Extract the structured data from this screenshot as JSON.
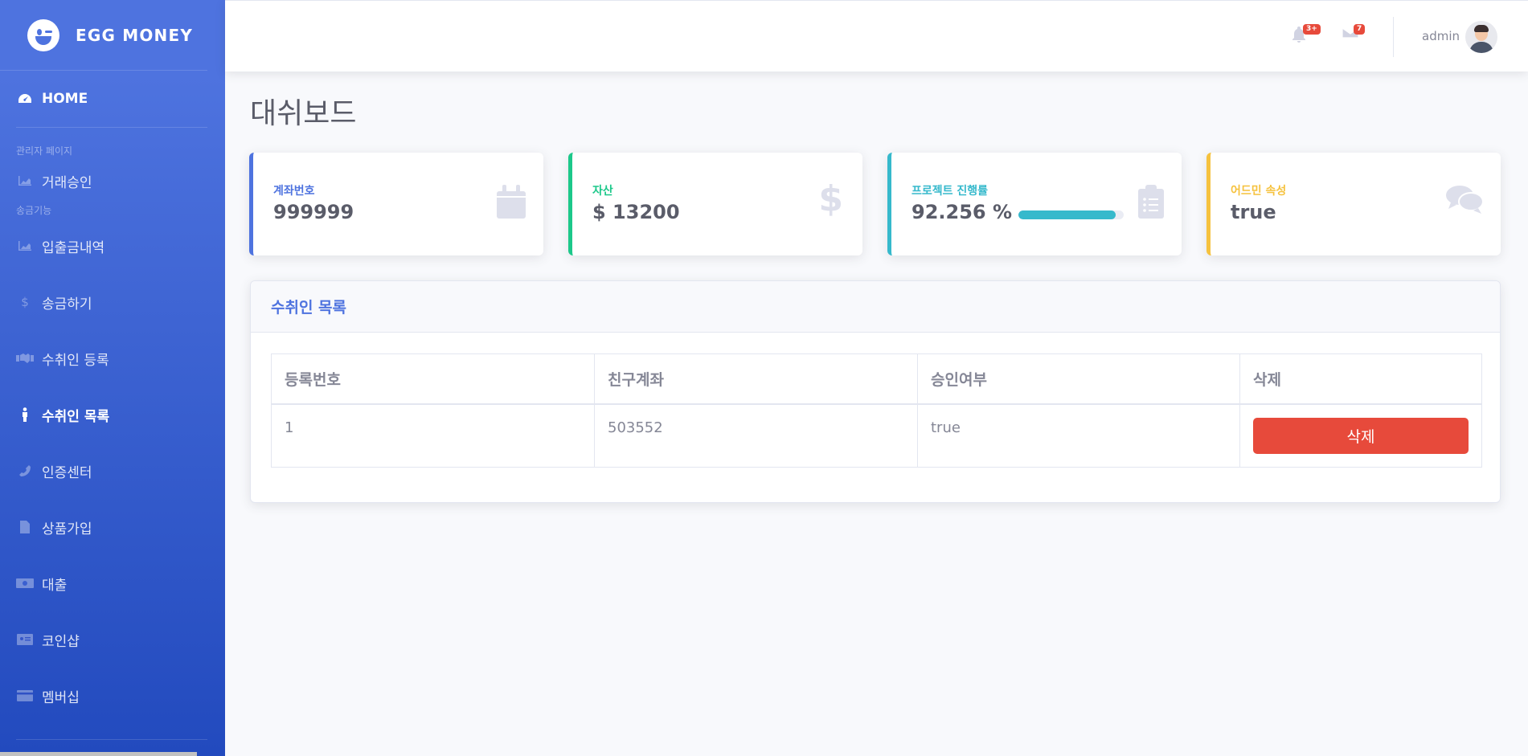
{
  "sidebar": {
    "brand": "EGG MONEY",
    "home": "HOME",
    "heading_admin": "관리자 페이지",
    "item_trade_approval": "거래승인",
    "heading_transfer": "송금기능",
    "items": [
      {
        "label": "입출금내역",
        "icon": "chart-area-icon"
      },
      {
        "label": "송금하기",
        "icon": "dollar-icon"
      },
      {
        "label": "수취인 등록",
        "icon": "handshake-icon"
      },
      {
        "label": "수취인 목록",
        "icon": "person-icon",
        "active": true
      },
      {
        "label": "인증센터",
        "icon": "phone-icon"
      },
      {
        "label": "상품가입",
        "icon": "file-icon"
      },
      {
        "label": "대출",
        "icon": "money-bill-icon"
      },
      {
        "label": "코인샵",
        "icon": "id-card-icon"
      },
      {
        "label": "멤버십",
        "icon": "credit-card-icon"
      }
    ]
  },
  "topbar": {
    "alerts_badge": "3+",
    "messages_badge": "7",
    "username": "admin"
  },
  "page": {
    "title": "대쉬보드"
  },
  "cards": {
    "account": {
      "label": "계좌번호",
      "value": "999999",
      "color": "#4e73df",
      "icon": "calendar-icon"
    },
    "assets": {
      "label": "자산",
      "value": "$ 13200",
      "color": "#1cc88a",
      "icon": "dollar-icon"
    },
    "progress": {
      "label": "프로젝트 진행률",
      "value": "92.256 %",
      "percent": 92.256,
      "color": "#36b9cc",
      "icon": "clipboard-list-icon"
    },
    "admin_attr": {
      "label": "어드민 속성",
      "value": "true",
      "color": "#f6c23e",
      "icon": "comments-icon"
    }
  },
  "recipients": {
    "title": "수취인 목록",
    "columns": [
      "등록번호",
      "친구계좌",
      "승인여부",
      "삭제"
    ],
    "rows": [
      {
        "id": "1",
        "account": "503552",
        "approved": "true",
        "delete_label": "삭제"
      }
    ]
  }
}
